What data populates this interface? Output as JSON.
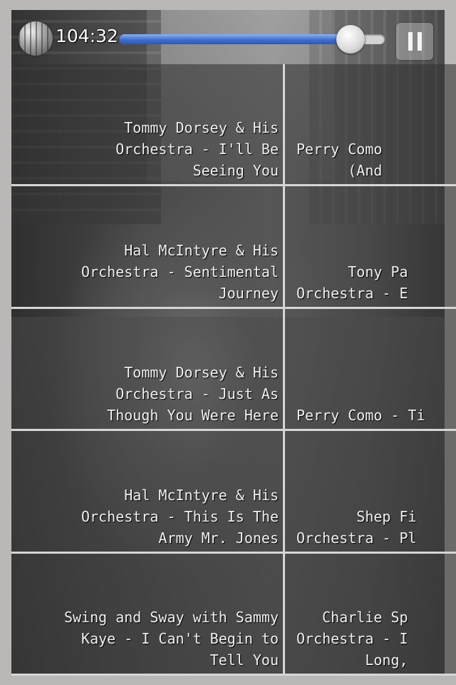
{
  "player": {
    "time": "104:32",
    "progress": 0.87
  },
  "icons": {
    "globe": "globe-icon",
    "pause": "pause-icon"
  },
  "colors": {
    "progress_fill": "#3d6fd0",
    "tile_border": "#d6d6d6",
    "tile_text": "#f0f0f0"
  },
  "tracks": [
    {
      "left_lines": [
        "Tommy Dorsey & His",
        "Orchestra - I'll Be",
        "Seeing You"
      ],
      "right_lines": [
        "Perry Como",
        "(And"
      ]
    },
    {
      "left_lines": [
        "Hal McIntyre & His",
        "Orchestra - Sentimental",
        "Journey"
      ],
      "right_lines": [
        "Tony Pa",
        "Orchestra - E"
      ]
    },
    {
      "left_lines": [
        "Tommy Dorsey & His",
        "Orchestra - Just As",
        "Though You Were Here"
      ],
      "right_lines": [
        "Perry Como - Ti"
      ]
    },
    {
      "left_lines": [
        "Hal McIntyre & His",
        "Orchestra - This Is The",
        "Army Mr. Jones"
      ],
      "right_lines": [
        "Shep Fi",
        "Orchestra - Pl"
      ]
    },
    {
      "left_lines": [
        "Swing and Sway with Sammy",
        "Kaye - I Can't Begin to",
        "Tell You"
      ],
      "right_lines": [
        "Charlie Sp",
        "Orchestra - I",
        "Long,"
      ]
    }
  ]
}
